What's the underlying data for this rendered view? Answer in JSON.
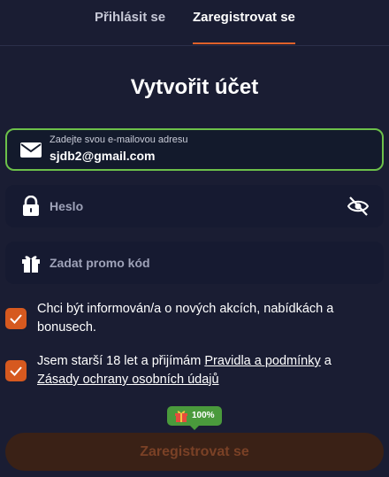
{
  "tabs": {
    "login": "Přihlásit se",
    "register": "Zaregistrovat se"
  },
  "form": {
    "title": "Vytvořit účet",
    "email": {
      "label": "Zadejte svou e-mailovou adresu",
      "value": "sjdb2@gmail.com"
    },
    "password": {
      "placeholder": "Heslo"
    },
    "promo": {
      "placeholder": "Zadat promo kód"
    },
    "newsletter": {
      "checked": true,
      "text": "Chci být informován/a o nových akcích, nabídkách a bonusech."
    },
    "terms": {
      "checked": true,
      "text_before": "Jsem starší 18 let a přijímám ",
      "link_rules": "Pravidla a podmínky",
      "text_middle": " a ",
      "link_privacy": "Zásady ochrany osobních údajů"
    },
    "bonus_badge": "100%",
    "submit_label": "Zaregistrovat se"
  },
  "colors": {
    "background": "#1a1d33",
    "accent": "#e0612a",
    "focus_border": "#6cc04a",
    "checkbox": "#d6591f",
    "badge": "#4a9a3c"
  },
  "icons": {
    "email": "envelope-icon",
    "password": "lock-icon",
    "visibility": "eye-off-icon",
    "promo": "gift-icon",
    "checkbox": "check-icon"
  }
}
